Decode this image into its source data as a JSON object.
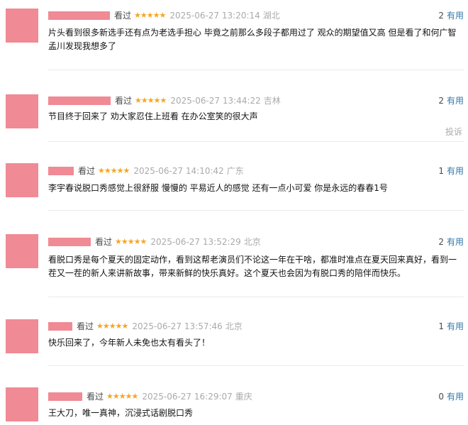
{
  "comments": [
    {
      "watched": "看过",
      "stars": "★★★★★",
      "time": "2025-06-27 13:20:14",
      "location": "湖北",
      "votes": "2",
      "useful": "有用",
      "content": "片头看到很多新选手还有点为老选手担心 毕竟之前那么多段子都用过了 观众的期望值又高 但是看了和何广智孟川发现我想多了"
    },
    {
      "watched": "看过",
      "stars": "★★★★★",
      "time": "2025-06-27 13:44:22",
      "location": "吉林",
      "votes": "2",
      "useful": "有用",
      "content": "节目终于回来了 劝大家忍住上班看 在办公室笑的很大声",
      "report": "投诉"
    },
    {
      "watched": "看过",
      "stars": "★★★★★",
      "time": "2025-06-27 14:10:42",
      "location": "广东",
      "votes": "1",
      "useful": "有用",
      "content": "李宇春说脱口秀感觉上很舒服 慢慢的 平易近人的感觉 还有一点小可爱 你是永远的春春1号"
    },
    {
      "watched": "看过",
      "stars": "★★★★★",
      "time": "2025-06-27 13:52:29",
      "location": "北京",
      "votes": "2",
      "useful": "有用",
      "content": "看脱口秀是每个夏天的固定动作，看到这帮老演员们不论这一年在干啥，都准时准点在夏天回来真好，看到一茬又一茬的新人来讲新故事，带来新鲜的快乐真好。这个夏天也会因为有脱口秀的陪伴而快乐。"
    },
    {
      "watched": "看过",
      "stars": "★★★★★",
      "time": "2025-06-27 13:57:46",
      "location": "北京",
      "votes": "1",
      "useful": "有用",
      "content": "快乐回来了，今年新人未免也太有看头了！"
    },
    {
      "watched": "看过",
      "stars": "★★★★★",
      "time": "2025-06-27 16:29:07",
      "location": "重庆",
      "votes": "0",
      "useful": "有用",
      "content": "王大刀，唯一真神，沉浸式话剧脱口秀"
    }
  ]
}
